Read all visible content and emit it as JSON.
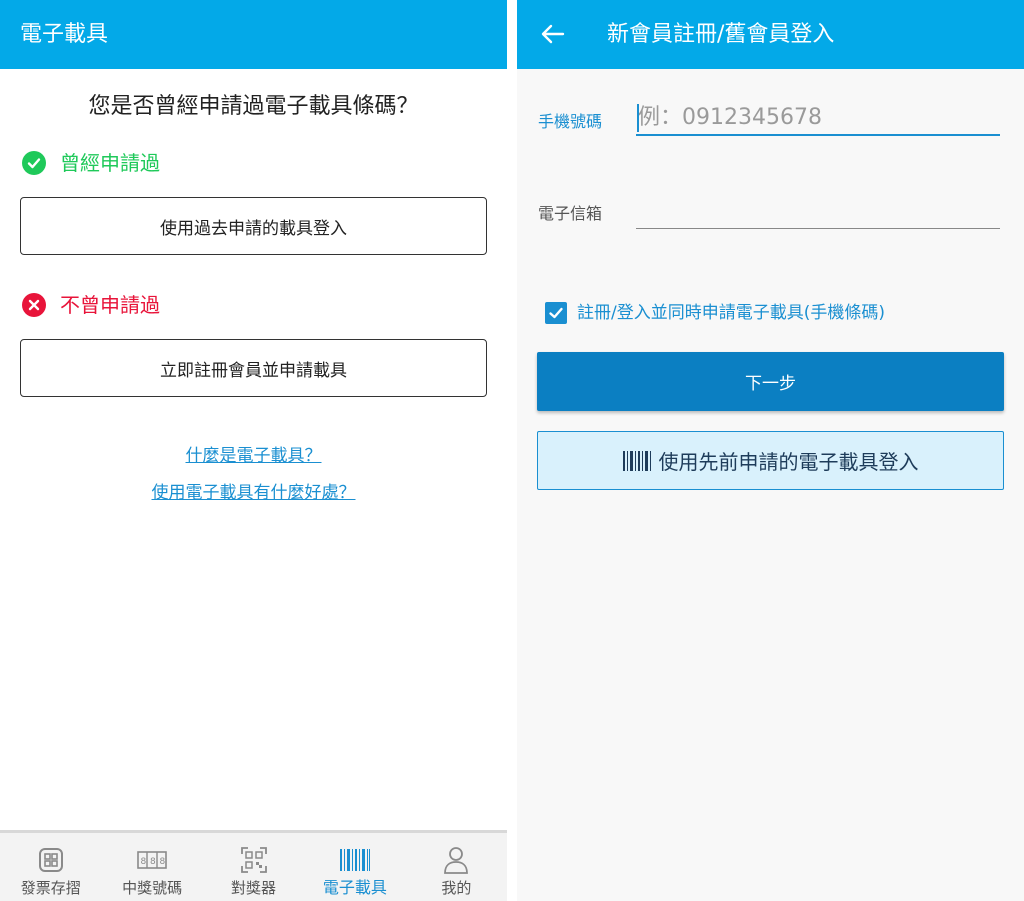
{
  "left": {
    "title": "電子載具",
    "question": "您是否曾經申請過電子載具條碼？",
    "yes_label": "曾經申請過",
    "login_old_button": "使用過去申請的載具登入",
    "no_label": "不曾申請過",
    "register_button": "立即註冊會員並申請載具",
    "link_what": "什麼是電子載具？",
    "link_benefits": "使用電子載具有什麼好處？",
    "nav": [
      {
        "label": "發票存摺",
        "icon": "receipt-book-icon"
      },
      {
        "label": "中獎號碼",
        "icon": "winning-numbers-icon"
      },
      {
        "label": "對獎器",
        "icon": "qr-scanner-icon"
      },
      {
        "label": "電子載具",
        "icon": "barcode-icon"
      },
      {
        "label": "我的",
        "icon": "person-icon"
      }
    ],
    "active_nav": "電子載具"
  },
  "right": {
    "title": "新會員註冊/舊會員登入",
    "phone_label": "手機號碼",
    "phone_placeholder": "例：0912345678",
    "phone_value": "",
    "email_label": "電子信箱",
    "email_value": "",
    "apply_checkbox_label": "註冊/登入並同時申請電子載具(手機條碼)",
    "apply_checkbox_checked": true,
    "next_button": "下一步",
    "carrier_login_button": "使用先前申請的電子載具登入"
  },
  "colors": {
    "header": "#03a9e8",
    "primary": "#0b7fc2",
    "link": "#1a8fd1",
    "success": "#1fc95a",
    "error": "#e8143a"
  }
}
